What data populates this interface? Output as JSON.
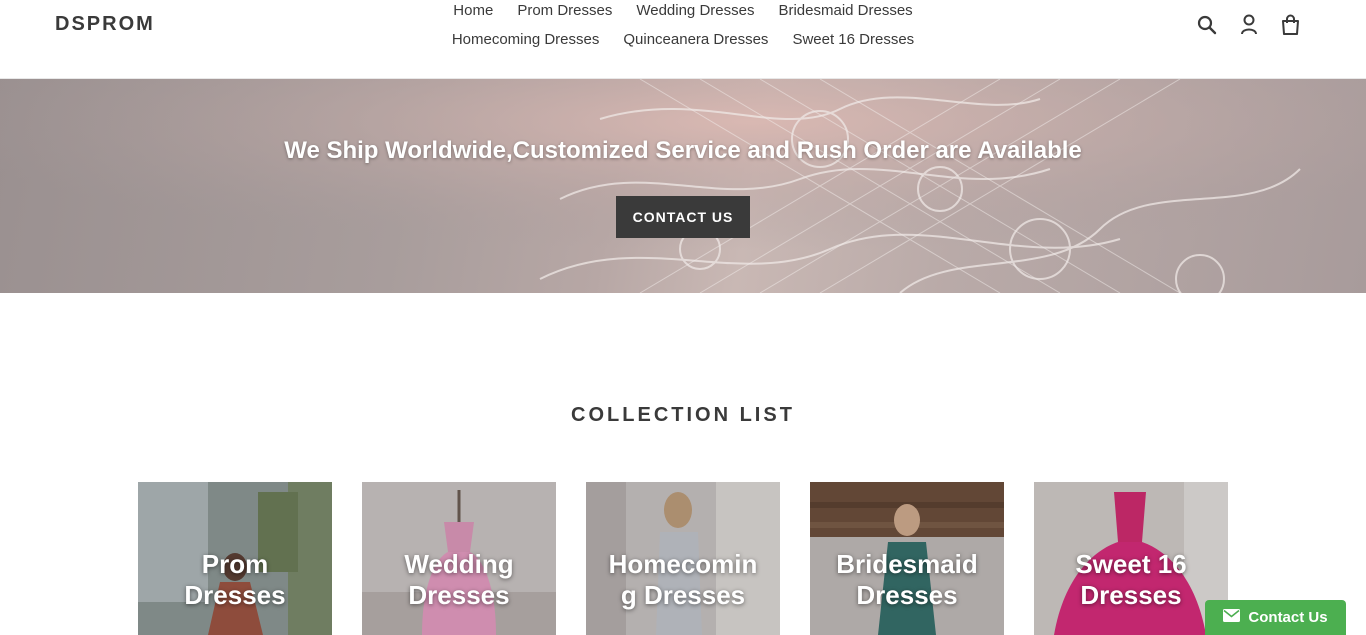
{
  "header": {
    "logo": "DSPROM",
    "nav_row1": [
      "Home",
      "Prom Dresses",
      "Wedding Dresses",
      "Bridesmaid Dresses"
    ],
    "nav_row2": [
      "Homecoming Dresses",
      "Quinceanera Dresses",
      "Sweet 16 Dresses"
    ],
    "icons": [
      "search-icon",
      "account-icon",
      "cart-icon"
    ]
  },
  "hero": {
    "headline": "We Ship Worldwide,Customized Service and Rush Order are Available",
    "button_label": "CONTACT US"
  },
  "collection": {
    "title": "COLLECTION LIST",
    "items": [
      {
        "label": "Prom Dresses",
        "line1": "Prom",
        "line2": "Dresses"
      },
      {
        "label": "Wedding Dresses",
        "line1": "Wedding",
        "line2": "Dresses"
      },
      {
        "label": "Homecoming Dresses",
        "line1": "Homecomin",
        "line2": "g Dresses"
      },
      {
        "label": "Bridesmaid Dresses",
        "line1": "Bridesmaid",
        "line2": "Dresses"
      },
      {
        "label": "Sweet 16 Dresses",
        "line1": "Sweet 16",
        "line2": "Dresses"
      }
    ]
  },
  "floating_contact": {
    "label": "Contact Us",
    "color": "#4caf50"
  }
}
